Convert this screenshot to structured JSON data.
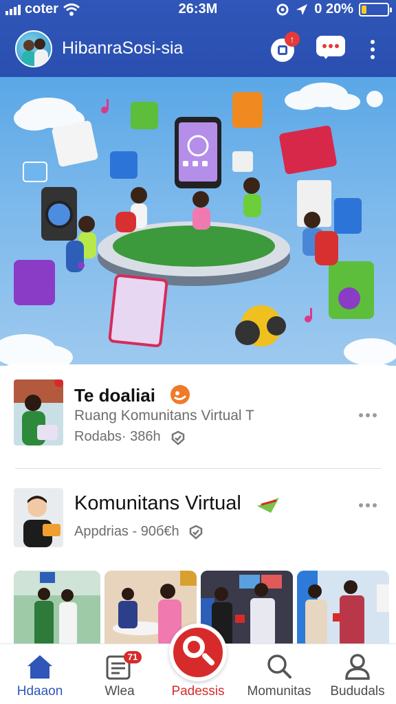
{
  "status_bar": {
    "carrier": "coter",
    "time": "26:3M",
    "battery_text": "0 20%",
    "battery_level": 0.2
  },
  "header": {
    "title": "HibanraSosi-sia",
    "notification_badge": "↑"
  },
  "feed": {
    "posts": [
      {
        "name": "Te doaliai",
        "subtitle": "Ruang Komunitans Virtual T",
        "meta": "Rodabs· 386h"
      },
      {
        "name": "Komunitans Virtual",
        "subtitle": "",
        "meta": "Appdrias - 90б€h"
      }
    ]
  },
  "bottom_nav": {
    "items": [
      {
        "label": "Hdaaon",
        "icon": "home-icon"
      },
      {
        "label": "Wlea",
        "icon": "feed-icon",
        "badge": "71"
      },
      {
        "label": "Padessis",
        "icon": "search-icon"
      },
      {
        "label": "Momunitas",
        "icon": "search-icon"
      },
      {
        "label": "Bududals",
        "icon": "user-icon"
      }
    ]
  },
  "colors": {
    "header_bg": "#2f56b8",
    "accent_red": "#d72b2b",
    "active_blue": "#2f56b8"
  }
}
